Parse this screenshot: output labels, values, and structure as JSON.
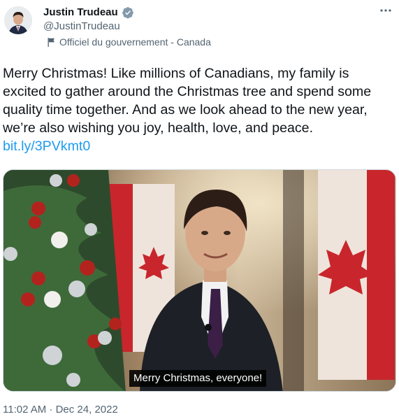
{
  "author": {
    "display_name": "Justin Trudeau",
    "handle": "@JustinTrudeau",
    "label": "Officiel du gouvernement - Canada",
    "verified_icon": "verified-badge-icon",
    "label_icon": "flag-icon",
    "avatar": "profile-photo"
  },
  "more_menu": {
    "icon": "ellipsis-icon"
  },
  "tweet": {
    "text": "Merry Christmas! Like millions of Canadians, my family is excited to gather around the Christmas tree and spend some quality time together. And as we look ahead to the new year, we’re also wishing you joy, health, love, and peace.",
    "link": "bit.ly/3PVkmt0"
  },
  "media": {
    "type": "video",
    "caption": "Merry Christmas, everyone!"
  },
  "meta": {
    "timestamp": "11:02 AM · Dec 24, 2022"
  },
  "colors": {
    "link": "#1d9bf0",
    "verified": "#829aab",
    "secondary_text": "#536471"
  }
}
